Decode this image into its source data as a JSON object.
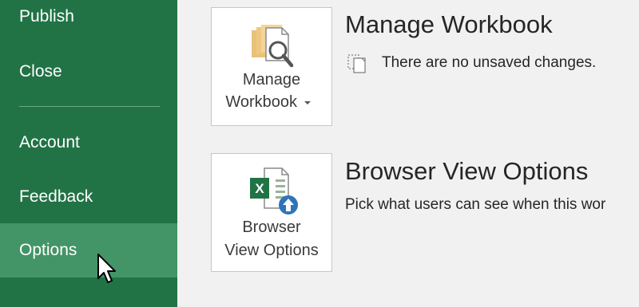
{
  "nav": {
    "items": [
      {
        "label": "Publish"
      },
      {
        "label": "Close"
      },
      {
        "label": "Account"
      },
      {
        "label": "Feedback"
      },
      {
        "label": "Options",
        "selected": true
      }
    ]
  },
  "manage_workbook": {
    "button_line1": "Manage",
    "button_line2": "Workbook",
    "title": "Manage Workbook",
    "status": "There are no unsaved changes."
  },
  "browser_view": {
    "button_line1": "Browser",
    "button_line2": "View Options",
    "title": "Browser View Options",
    "description": "Pick what users can see when this wor"
  },
  "colors": {
    "sidebar_bg": "#217346",
    "selected_bg": "#439467",
    "content_bg": "#f1f1f1"
  },
  "icons": [
    "manage-workbook-icon",
    "dropdown-arrow-icon",
    "document-versions-icon",
    "browser-view-options-icon",
    "mouse-pointer-icon"
  ]
}
